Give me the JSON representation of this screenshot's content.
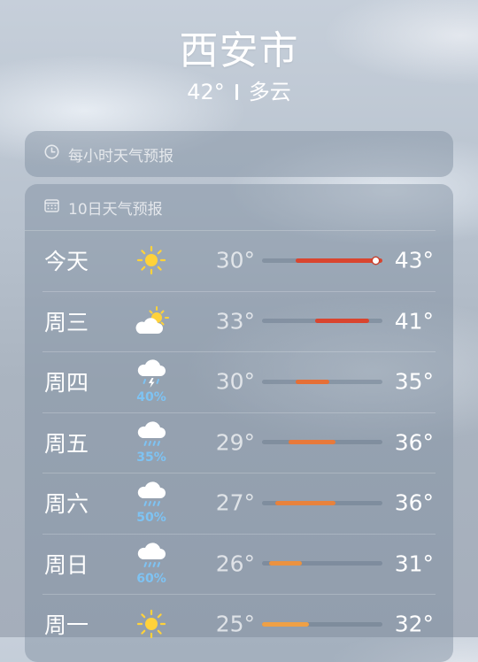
{
  "location": {
    "city": "西安市",
    "temperature": "42°",
    "condition": "多云"
  },
  "hourly": {
    "label": "每小时天气预报",
    "icon": "clock-icon"
  },
  "daily": {
    "label": "10日天气预报",
    "icon": "calendar-icon",
    "range_min": 25,
    "range_max": 43,
    "days": [
      {
        "day": "今天",
        "icon": "sun-icon",
        "low": "30°",
        "high": "43°",
        "low_val": 30,
        "high_val": 43,
        "precip": "",
        "current_val": 42,
        "bar_color": "#d9452f"
      },
      {
        "day": "周三",
        "icon": "partly-cloudy-icon",
        "low": "33°",
        "high": "41°",
        "low_val": 33,
        "high_val": 41,
        "precip": "",
        "bar_color": "#d9452f"
      },
      {
        "day": "周四",
        "icon": "thunderstorm-icon",
        "low": "30°",
        "high": "35°",
        "low_val": 30,
        "high_val": 35,
        "precip": "40%",
        "bar_color": "#e56f36"
      },
      {
        "day": "周五",
        "icon": "rain-icon",
        "low": "29°",
        "high": "36°",
        "low_val": 29,
        "high_val": 36,
        "precip": "35%",
        "bar_color": "#e8793a"
      },
      {
        "day": "周六",
        "icon": "rain-icon",
        "low": "27°",
        "high": "36°",
        "low_val": 27,
        "high_val": 36,
        "precip": "50%",
        "bar_color": "#e8823c"
      },
      {
        "day": "周日",
        "icon": "rain-icon",
        "low": "26°",
        "high": "31°",
        "low_val": 26,
        "high_val": 31,
        "precip": "60%",
        "bar_color": "#eb9240"
      },
      {
        "day": "周一",
        "icon": "sun-icon",
        "low": "25°",
        "high": "32°",
        "low_val": 25,
        "high_val": 32,
        "precip": "",
        "bar_color": "#efa045"
      }
    ]
  },
  "colors": {
    "precip_text": "#7ec3f3",
    "sun": "#ffd23a"
  }
}
